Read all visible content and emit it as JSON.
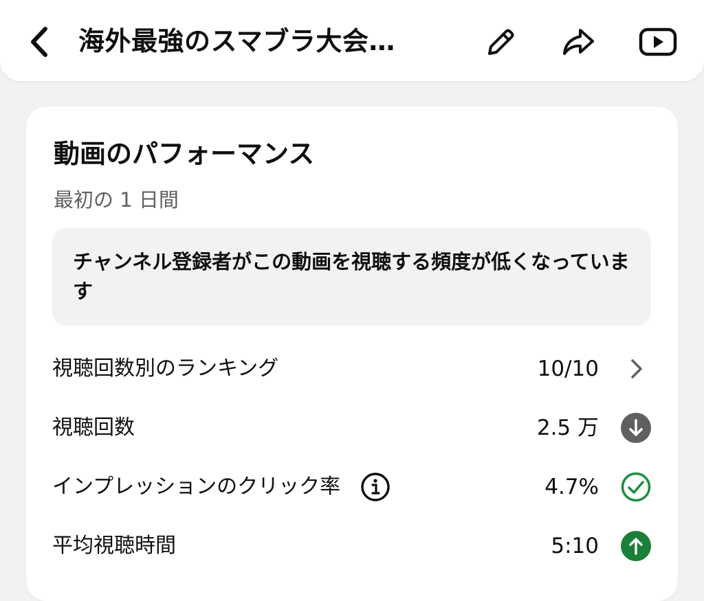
{
  "header": {
    "title": "海外最強のスマブラ大会…",
    "back_icon": "chevron-left-icon",
    "edit_icon": "pencil-icon",
    "share_icon": "share-icon",
    "youtube_icon": "youtube-play-icon"
  },
  "performance": {
    "title": "動画のパフォーマンス",
    "period": "最初の 1 日間",
    "insight": "チャンネル登録者がこの動画を視聴する頻度が低くなっています",
    "metrics": [
      {
        "label": "視聴回数別のランキング",
        "value": "10/10",
        "icon": "chevron-right-icon"
      },
      {
        "label": "視聴回数",
        "value": "2.5 万",
        "icon": "down-arrow-icon",
        "status_color": "#606060"
      },
      {
        "label": "インプレッションのクリック率",
        "value": "4.7%",
        "icon": "check-circle-icon",
        "info_icon": "info-icon",
        "status_color": "#1e8e3e"
      },
      {
        "label": "平均視聴時間",
        "value": "5:10",
        "icon": "up-arrow-icon",
        "status_color": "#1a7f37"
      }
    ]
  }
}
